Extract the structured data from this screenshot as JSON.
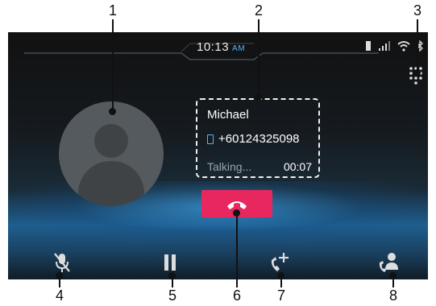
{
  "callouts": [
    "1",
    "2",
    "3",
    "4",
    "5",
    "6",
    "7",
    "8"
  ],
  "status": {
    "time": "10:13",
    "ampm": "AM"
  },
  "contact": {
    "name": "Michael",
    "number": "+60124325098",
    "state": "Talking...",
    "duration": "00:07"
  },
  "icons": {
    "dialpad": "dialpad-icon",
    "mute": "mic-mute-icon",
    "hold": "pause-icon",
    "add_call": "add-call-icon",
    "contacts": "contacts-icon",
    "end_call": "end-call-icon"
  },
  "colors": {
    "accent_blue": "#4fb6ff",
    "end_call_red": "#e8275e"
  }
}
